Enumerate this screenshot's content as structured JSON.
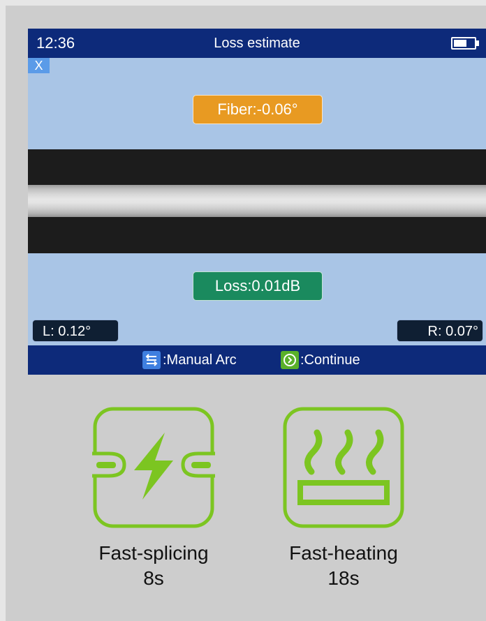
{
  "statusbar": {
    "time": "12:36",
    "title": "Loss estimate",
    "battery_icon": "battery-icon"
  },
  "close_button": {
    "label": "X"
  },
  "fiber_badge": {
    "text": "Fiber:-0.06°"
  },
  "loss_badge": {
    "text": "Loss:0.01dB"
  },
  "angles": {
    "left": "L: 0.12°",
    "right": "R: 0.07°"
  },
  "hints": {
    "manual_arc": ":Manual Arc",
    "continue": ":Continue"
  },
  "features": {
    "splicing": {
      "name": "Fast-splicing",
      "time": "8s"
    },
    "heating": {
      "name": "Fast-heating",
      "time": "18s"
    }
  },
  "colors": {
    "statusbar": "#0d2a7a",
    "screen": "#a9c5e6",
    "fiber_badge": "#e89a22",
    "loss_badge": "#1a8a5e",
    "feature_icon": "#7cc521"
  }
}
